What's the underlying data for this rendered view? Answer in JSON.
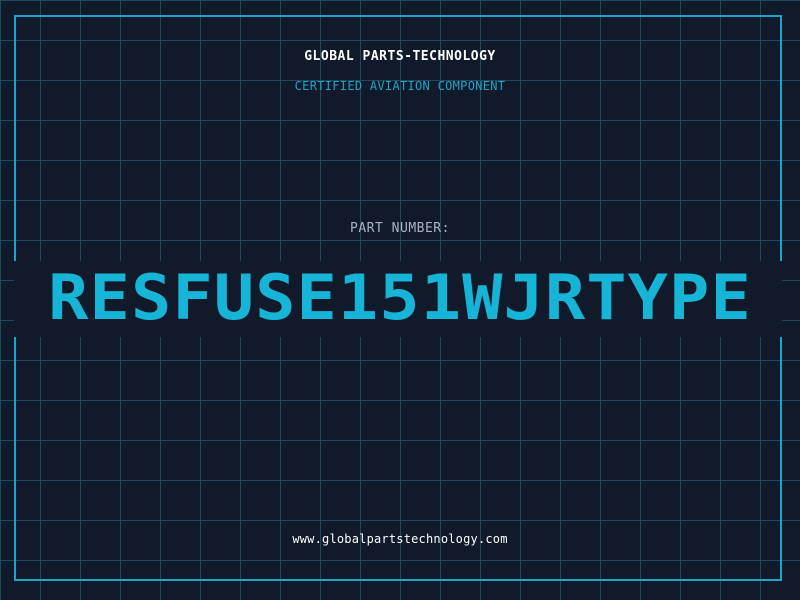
{
  "header": {
    "company": "GLOBAL PARTS-TECHNOLOGY",
    "subtitle": "CERTIFIED AVIATION COMPONENT"
  },
  "part": {
    "label": "PART NUMBER:",
    "number": "RESFUSE151WJRTYPE"
  },
  "footer": {
    "website": "www.globalpartstechnology.com"
  },
  "colors": {
    "background": "#111a2b",
    "grid": "#1e4a5e",
    "accent": "#1aa6c8",
    "part_number": "#16b4d6",
    "text_primary": "#ffffff",
    "text_muted": "#a8b3c4"
  }
}
